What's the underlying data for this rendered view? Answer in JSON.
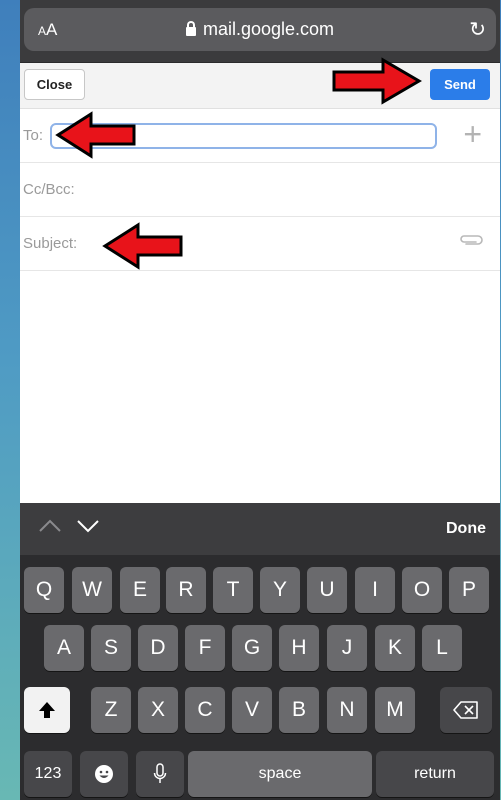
{
  "browser": {
    "aa_label": "AA",
    "url": "mail.google.com",
    "reload_icon": "reload-icon"
  },
  "compose": {
    "close_label": "Close",
    "send_label": "Send",
    "to_label": "To:",
    "to_value": "",
    "ccbcc_label": "Cc/Bcc:",
    "subject_label": "Subject:",
    "add_recipient_icon": "plus-icon",
    "attach_icon": "paperclip-icon"
  },
  "annotations": {
    "arrow_color": "#e8131a"
  },
  "keyboard_toolbar": {
    "done_label": "Done"
  },
  "keyboard": {
    "row1": [
      "Q",
      "W",
      "E",
      "R",
      "T",
      "Y",
      "U",
      "I",
      "O",
      "P"
    ],
    "row2": [
      "A",
      "S",
      "D",
      "F",
      "G",
      "H",
      "J",
      "K",
      "L"
    ],
    "row3": [
      "Z",
      "X",
      "C",
      "V",
      "B",
      "N",
      "M"
    ],
    "numbers_label": "123",
    "space_label": "space",
    "return_label": "return"
  }
}
